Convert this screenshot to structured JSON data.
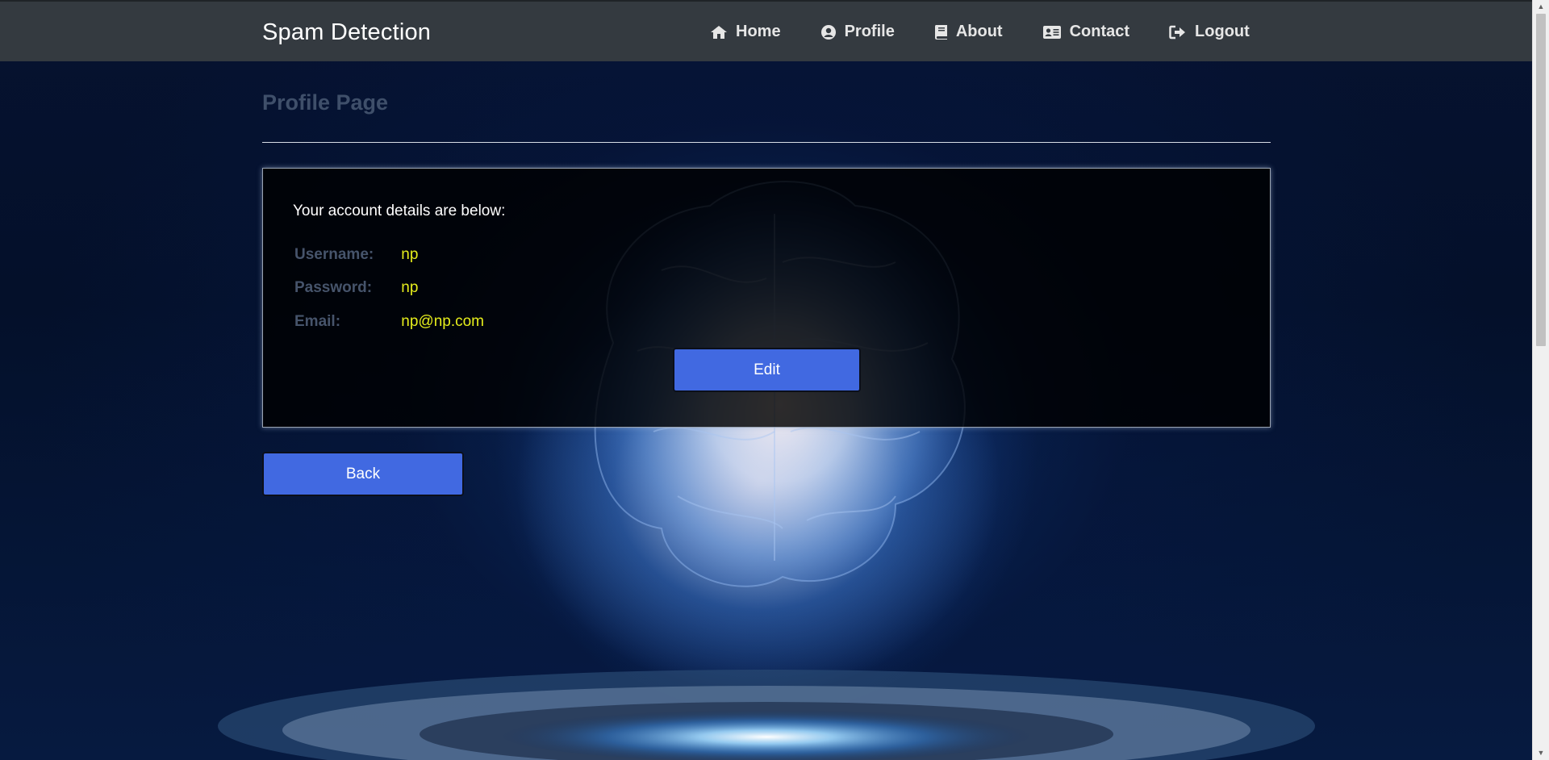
{
  "navbar": {
    "brand": "Spam Detection",
    "items": [
      {
        "label": "Home",
        "icon": "home-icon"
      },
      {
        "label": "Profile",
        "icon": "user-circle-icon"
      },
      {
        "label": "About",
        "icon": "book-icon"
      },
      {
        "label": "Contact",
        "icon": "address-card-icon"
      },
      {
        "label": "Logout",
        "icon": "sign-out-icon"
      }
    ]
  },
  "page": {
    "title": "Profile Page"
  },
  "account": {
    "intro": "Your account details are below:",
    "fields": [
      {
        "label": "Username:",
        "value": "np"
      },
      {
        "label": "Password:",
        "value": "np"
      },
      {
        "label": "Email:",
        "value": "np@np.com"
      }
    ],
    "edit_label": "Edit"
  },
  "back_label": "Back",
  "colors": {
    "navbar_bg": "#343a40",
    "button_bg": "#4169e1",
    "value_text": "#e6ee1c",
    "label_text": "#46546b"
  }
}
